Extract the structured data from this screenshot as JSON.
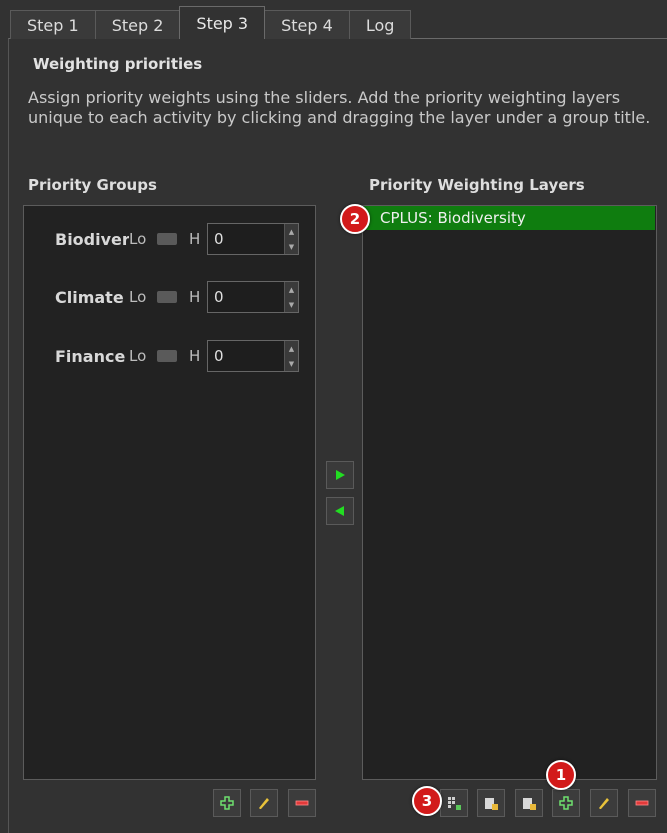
{
  "tabs": [
    {
      "label": "Step 1"
    },
    {
      "label": "Step 2"
    },
    {
      "label": "Step 3"
    },
    {
      "label": "Step 4"
    },
    {
      "label": "Log"
    }
  ],
  "active_tab": "Step 3",
  "section": {
    "title": "Weighting priorities",
    "description": "Assign priority weights using the sliders. Add the priority weighting layers unique to each activity by clicking and dragging the layer under a group title."
  },
  "priority_groups": {
    "title": "Priority Groups",
    "low_label": "Lo",
    "high_label": "H",
    "items": [
      {
        "name": "Biodiver",
        "value": "0"
      },
      {
        "name": "Climate",
        "value": "0"
      },
      {
        "name": "Finance",
        "value": "0"
      }
    ]
  },
  "priority_layers": {
    "title": "Priority Weighting Layers",
    "items": [
      {
        "label": "CPLUS: Biodiversity",
        "selected": true
      }
    ]
  },
  "colors": {
    "selected_layer": "#0f7d0f",
    "badge": "#d21a1a",
    "arrow": "#22dd22"
  },
  "badges": [
    "1",
    "2",
    "3"
  ],
  "icons": {
    "move_right": "green-right-arrow-icon",
    "move_left": "green-left-arrow-icon",
    "add": "add-icon",
    "edit": "pencil-icon",
    "remove": "remove-icon",
    "add_layer": "add-icon",
    "edit_layer": "pencil-icon",
    "remove_layer": "remove-icon",
    "layer_tool_1": "grid-add-icon",
    "layer_tool_2": "layer-import-icon",
    "layer_tool_3": "layer-export-icon"
  }
}
